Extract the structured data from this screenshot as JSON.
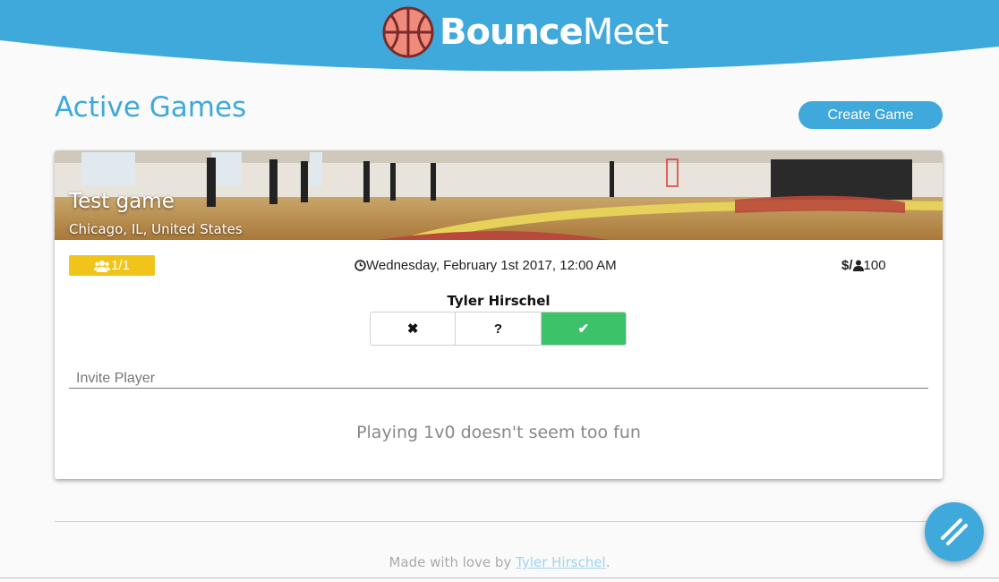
{
  "brand": {
    "name_bold": "Bounce",
    "name_light": "Meet",
    "primary_color": "#3fa9db"
  },
  "page": {
    "title": "Active Games",
    "create_label": "Create Game"
  },
  "game": {
    "name": "Test game",
    "location": "Chicago, IL, United States",
    "players": "1/1",
    "datetime": "Wednesday, February 1st 2017, 12:00 AM",
    "cost_symbol": "$/",
    "cost_value": "100",
    "rsvp": {
      "player": "Tyler Hirschel",
      "options": [
        "✖",
        "?",
        "✔"
      ],
      "selected": "✔"
    },
    "invite_placeholder": "Invite Player",
    "empty_message": "Playing 1v0 doesn't seem too fun"
  },
  "footer": {
    "prefix": "Made with love by ",
    "author": "Tyler Hirschel",
    "suffix": "."
  },
  "icons": {
    "players": "users-icon",
    "time": "clock-icon",
    "per_person": "user-icon",
    "fab": "menu-slashes-icon",
    "logo": "basketball-icon"
  }
}
